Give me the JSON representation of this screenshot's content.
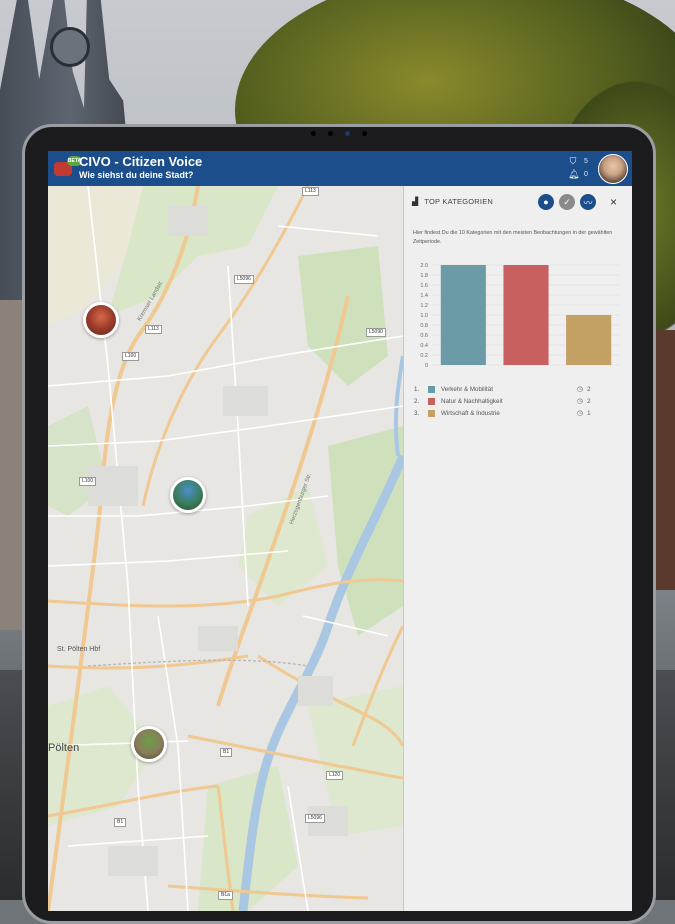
{
  "app": {
    "title": "CIVO - Citizen Voice",
    "subtitle": "Wie siehst du deine Stadt?",
    "beta_badge": "BETA"
  },
  "topbar": {
    "pin_count": "5",
    "notification_count": "0",
    "pin_icon": "location-pin-icon",
    "bell_icon": "bell-icon"
  },
  "map": {
    "place_label": "Pölten",
    "station_label": "St. Pölten Hbf",
    "road_tags": [
      "L113",
      "L5096",
      "L113",
      "L100",
      "L5090",
      "L100",
      "B1",
      "L120",
      "L5096",
      "B1",
      "B1a"
    ],
    "streets": [
      "Herzogenburger Str.",
      "Kremser Landstr."
    ]
  },
  "panel": {
    "title": "TOP KATEGORIEN",
    "description": "Hier findest Du die 10 Kategorien mit den meisten Beobachtungen in der gewählten Zeitperiode.",
    "close_label": "×",
    "buttons": [
      "user-icon",
      "thumbs-up-icon",
      "trend-icon"
    ]
  },
  "chart_data": {
    "type": "bar",
    "categories": [
      "Verkehr & Mobilität",
      "Natur & Nachhaltigkeit",
      "Wirtschaft & Industrie"
    ],
    "values": [
      2,
      2,
      1
    ],
    "colors": [
      "#6b9ba6",
      "#c86060",
      "#c3a064"
    ],
    "ylim": [
      0,
      2.0
    ],
    "yticks": [
      "0",
      "0.2",
      "0.4",
      "0.6",
      "0.8",
      "1.0",
      "1.2",
      "1.4",
      "1.6",
      "1.8",
      "2.0"
    ],
    "grid": true,
    "xlabel": "",
    "ylabel": ""
  },
  "legend": [
    {
      "num": "1.",
      "name": "Verkehr & Mobilität",
      "count": "2",
      "color": "#6b9ba6"
    },
    {
      "num": "2.",
      "name": "Natur & Nachhaltigkeit",
      "count": "2",
      "color": "#c86060"
    },
    {
      "num": "3.",
      "name": "Wirtschaft & Industrie",
      "count": "1",
      "color": "#c3a064"
    }
  ]
}
